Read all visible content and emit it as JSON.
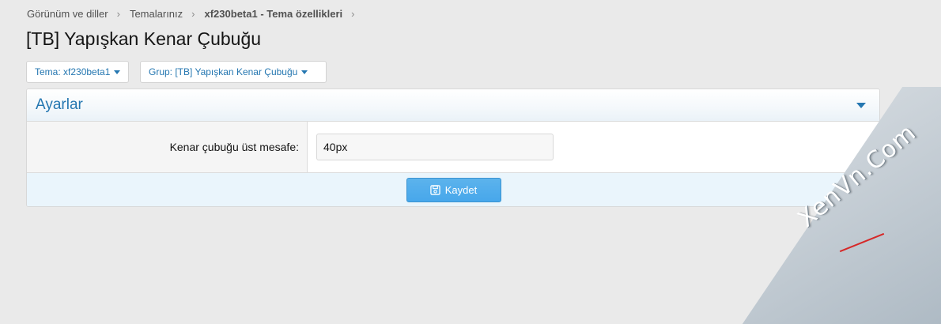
{
  "breadcrumb": {
    "items": [
      "Görünüm ve diller",
      "Temalarınız",
      "xf230beta1"
    ],
    "current_suffix": "- Tema özellikleri",
    "separator": "›"
  },
  "page_title": "[TB] Yapışkan Kenar Çubuğu",
  "filters": {
    "theme": "Tema: xf230beta1",
    "group": "Grup: [TB] Yapışkan Kenar Çubuğu"
  },
  "panel": {
    "title": "Ayarlar",
    "field_label": "Kenar çubuğu üst mesafe:",
    "field_value": "40px",
    "save_label": "Kaydet"
  },
  "icons": {
    "save": "save-icon",
    "collapse": "chevron-down-icon",
    "caret": "caret-down-icon"
  },
  "colors": {
    "accent": "#2577b1",
    "button": "#47a7eb",
    "footer": "#eaf5fc"
  },
  "watermark": "XenVn.Com"
}
